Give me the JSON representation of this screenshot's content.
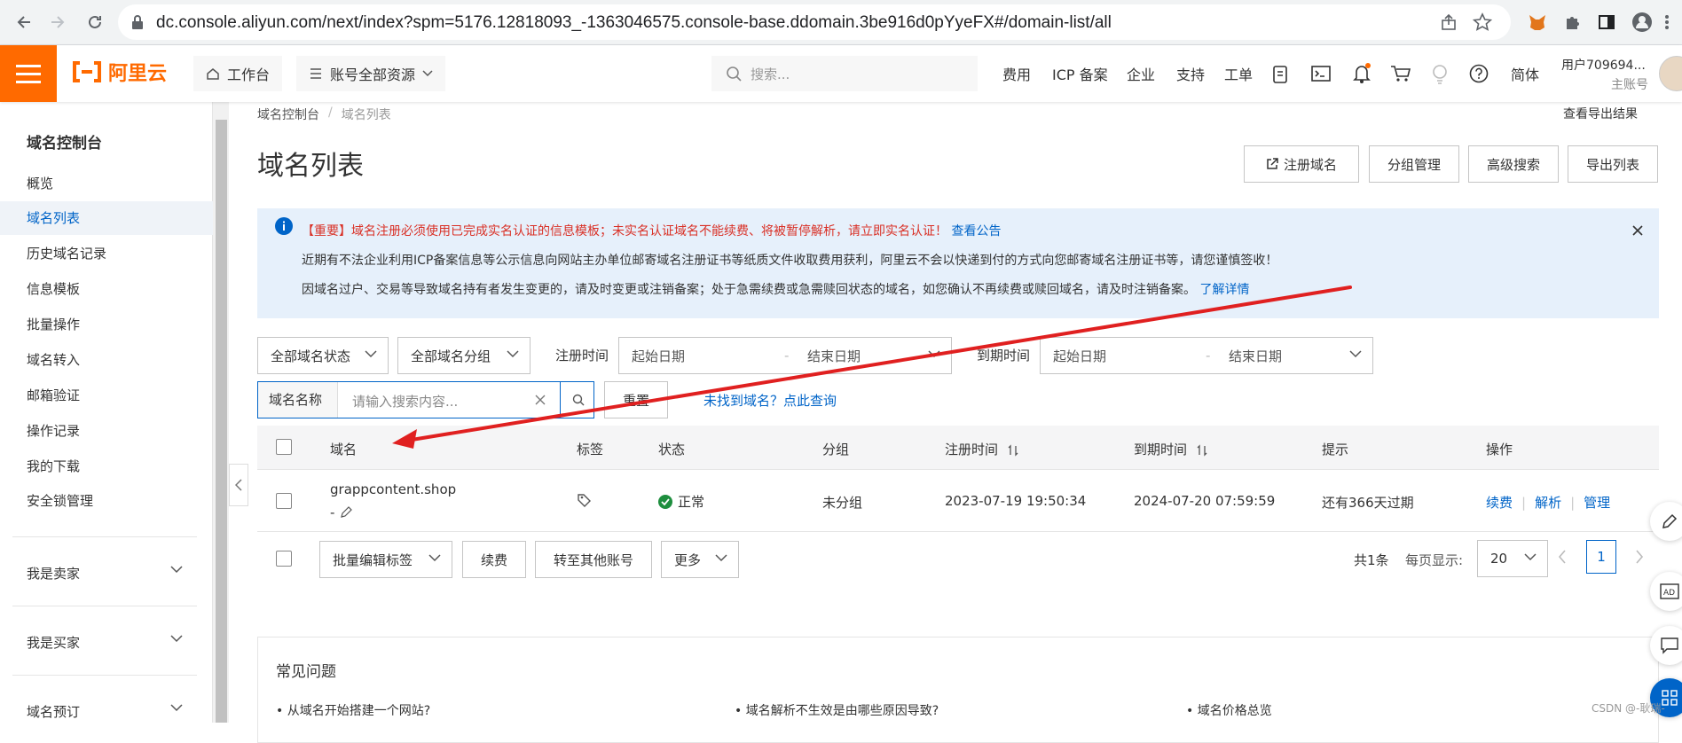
{
  "browser": {
    "url": "dc.console.aliyun.com/next/index?spm=5176.12818093_-1363046575.console-base.ddomain.3be916d0pYyeFX#/domain-list/all"
  },
  "topbar": {
    "logo": "阿里云",
    "workbench": "工作台",
    "resources": "账号全部资源",
    "search_placeholder": "搜索...",
    "nav": [
      "费用",
      "ICP 备案",
      "企业",
      "支持",
      "工单"
    ],
    "lang": "简体",
    "user_name": "用户709694...",
    "user_role": "主账号",
    "accent": "#ff6a00"
  },
  "sidebar": {
    "title": "域名控制台",
    "items": [
      "概览",
      "域名列表",
      "历史域名记录",
      "信息模板",
      "批量操作",
      "域名转入",
      "邮箱验证",
      "操作记录",
      "我的下载",
      "安全锁管理"
    ],
    "active_index": 1,
    "groups": [
      "我是卖家",
      "我是买家",
      "域名预订"
    ]
  },
  "breadcrumb": {
    "root": "域名控制台",
    "separator": "/",
    "current": "域名列表"
  },
  "page": {
    "title": "域名列表",
    "export_results": "查看导出结果",
    "actions": {
      "register": "注册域名",
      "group": "分组管理",
      "advanced": "高级搜索",
      "export": "导出列表"
    }
  },
  "notice": {
    "line1_red": "【重要】域名注册必须使用已完成实名认证的信息模板；未实名认证域名不能续费、将被暂停解析，请立即实名认证！",
    "line1_link": "查看公告",
    "line2": "近期有不法企业利用ICP备案信息等公示信息向网站主办单位邮寄域名注册证书等纸质文件收取费用获利，阿里云不会以快递到付的方式向您邮寄域名注册证书等，请您谨慎签收！",
    "line3": "因域名过户、交易等导致域名持有者发生变更的，请及时变更或注销备案；处于急需续费或急需赎回状态的域名，如您确认不再续费或赎回域名，请及时注销备案。",
    "line3_link": "了解详情"
  },
  "filters": {
    "status": "全部域名状态",
    "group": "全部域名分组",
    "reg_label": "注册时间",
    "exp_label": "到期时间",
    "start_placeholder": "起始日期",
    "end_placeholder": "结束日期",
    "search_field": "域名名称",
    "search_placeholder": "请输入搜索内容...",
    "reset": "重置",
    "not_found": "未找到域名？点此查询"
  },
  "table": {
    "headers": [
      "域名",
      "标签",
      "状态",
      "分组",
      "注册时间",
      "到期时间",
      "提示",
      "操作"
    ],
    "rows": [
      {
        "domain": "grappcontent.shop",
        "sub": "-",
        "status": "正常",
        "group": "未分组",
        "registered": "2023-07-19 19:50:34",
        "expires": "2024-07-20 07:59:59",
        "hint": "还有366天过期",
        "ops": [
          "续费",
          "解析",
          "管理"
        ]
      }
    ]
  },
  "bulk": {
    "edit_tags": "批量编辑标签",
    "renew": "续费",
    "transfer": "转至其他账号",
    "more": "更多",
    "total": "共1条",
    "per_page_label": "每页显示:",
    "per_page": "20",
    "page": "1"
  },
  "faq": {
    "title": "常见问题",
    "items": [
      "• 从域名开始搭建一个网站?",
      "• 域名解析不生效是由哪些原因导致?",
      "• 域名价格总览"
    ]
  },
  "watermark": "CSDN @-耿瑞-"
}
